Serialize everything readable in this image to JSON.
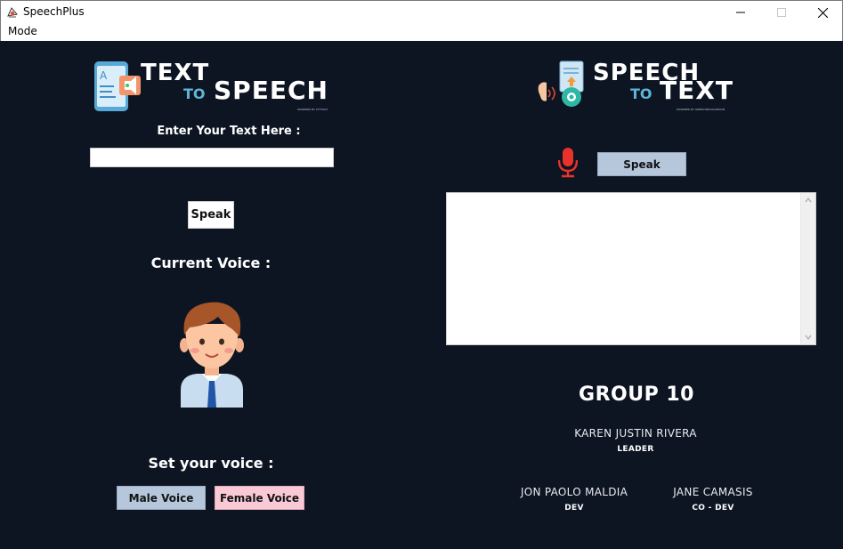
{
  "window": {
    "title": "SpeechPlus",
    "menu": [
      "Mode"
    ]
  },
  "text_to_speech": {
    "logo_line1": "TEXT",
    "logo_to": "TO",
    "logo_line2": "SPEECH",
    "logo_powered": "POWERED BY PYTTSX3",
    "input_label": "Enter Your Text Here :",
    "input_value": "",
    "speak_button": "Speak",
    "current_voice_label": "Current Voice :",
    "set_voice_label": "Set your voice :",
    "male_button": "Male Voice",
    "female_button": "Female Voice"
  },
  "speech_to_text": {
    "logo_line1": "SPEECH",
    "logo_to": "TO",
    "logo_line2": "TEXT",
    "logo_powered": "POWERED BY SPEECHRECOGNITION",
    "speak_button": "Speak",
    "output_text": ""
  },
  "team": {
    "title": "GROUP 10",
    "members": [
      {
        "name": "KAREN JUSTIN RIVERA",
        "role": "LEADER"
      },
      {
        "name": "JON PAOLO MALDIA",
        "role": "DEV"
      },
      {
        "name": "JANE CAMASIS",
        "role": "CO - DEV"
      }
    ]
  },
  "colors": {
    "background": "#0d1523",
    "accent_blue": "#b6c7dc",
    "accent_pink": "#f9c9d6",
    "mic_red": "#e8322b"
  }
}
